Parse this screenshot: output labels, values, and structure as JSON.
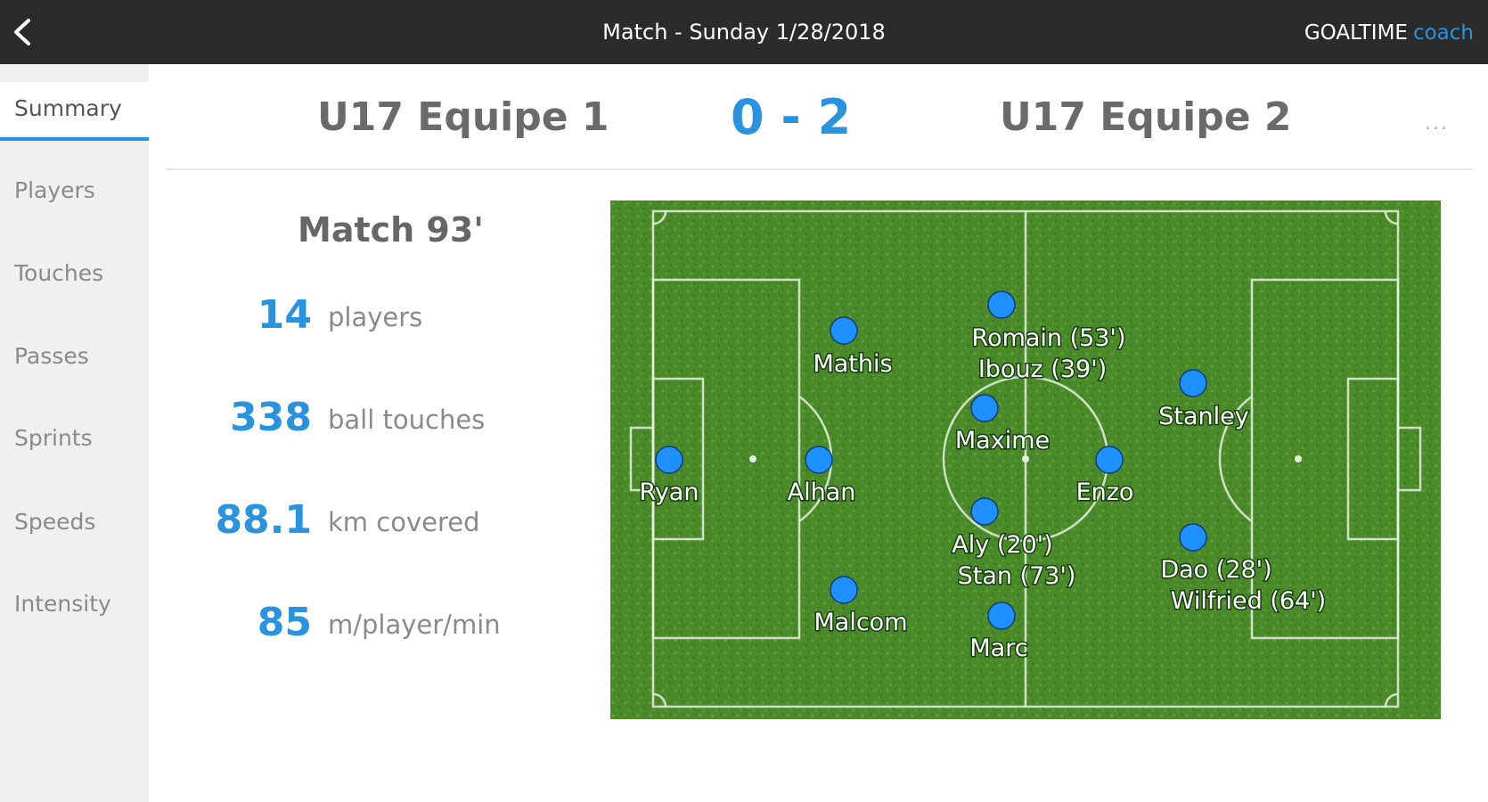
{
  "header": {
    "title": "Match - Sunday 1/28/2018",
    "brand_main": "GOALTIME",
    "brand_accent": "coach",
    "back_icon": "chevron-left-icon"
  },
  "sidebar": {
    "items": [
      {
        "label": "Summary",
        "active": true
      },
      {
        "label": "Players",
        "active": false
      },
      {
        "label": "Touches",
        "active": false
      },
      {
        "label": "Passes",
        "active": false
      },
      {
        "label": "Sprints",
        "active": false
      },
      {
        "label": "Speeds",
        "active": false
      },
      {
        "label": "Intensity",
        "active": false
      }
    ]
  },
  "scoreboard": {
    "home_team": "U17 Equipe 1",
    "score": "0 - 2",
    "away_team": "U17 Equipe 2",
    "more_label": "..."
  },
  "stats": {
    "match_time": "Match 93'",
    "items": [
      {
        "value": "14",
        "label": "players"
      },
      {
        "value": "338",
        "label": "ball touches"
      },
      {
        "value": "88.1",
        "label": "km covered"
      },
      {
        "value": "85",
        "label": "m/player/min"
      }
    ]
  },
  "pitch": {
    "players": [
      {
        "name": "Ryan"
      },
      {
        "name": "Mathis"
      },
      {
        "name": "Alhan"
      },
      {
        "name": "Malcom"
      },
      {
        "name": "Romain (53')",
        "sub": "Ibouz (39')"
      },
      {
        "name": "Maxime"
      },
      {
        "name": "Aly (20')",
        "sub": "Stan (73')"
      },
      {
        "name": "Marc"
      },
      {
        "name": "Enzo"
      },
      {
        "name": "Stanley"
      },
      {
        "name": "Dao (28')",
        "sub": "Wilfried (64')"
      }
    ]
  },
  "colors": {
    "accent": "#2a93e0",
    "header_bg": "#2b2b2b",
    "pitch_green": "#4e8f2c",
    "player_dot": "#1e90ff"
  }
}
